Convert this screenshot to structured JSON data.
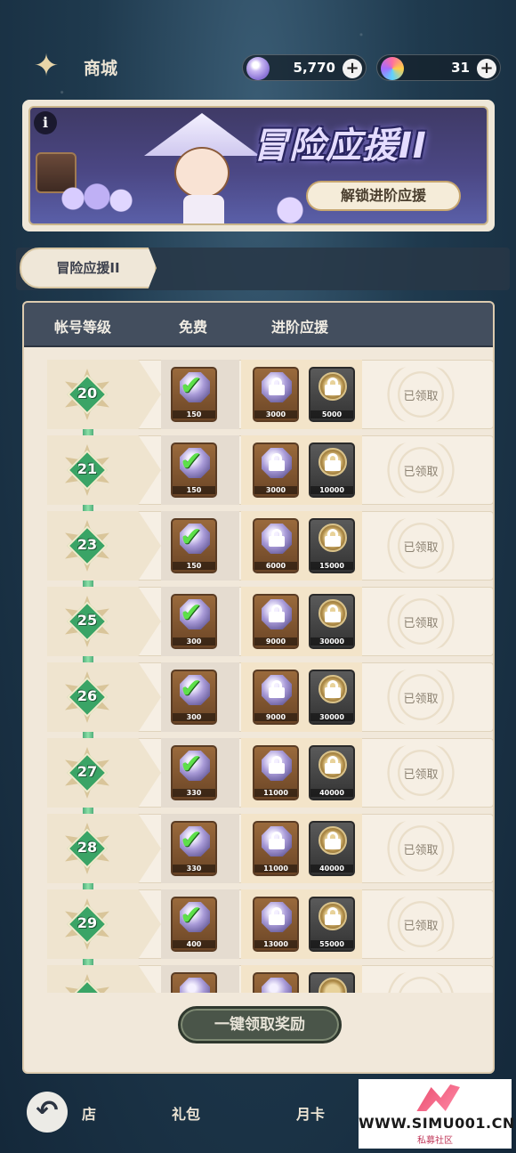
{
  "header": {
    "title": "商城",
    "currency_gems": "5,770",
    "currency_coins": "31",
    "plus": "+"
  },
  "banner": {
    "info": "i",
    "title": "冒险应援II",
    "unlock_button": "解锁进阶应援"
  },
  "tabs": [
    {
      "label": "冒险应援II",
      "active": true
    }
  ],
  "table": {
    "col_level": "帐号等级",
    "col_free": "免费",
    "col_advanced": "进阶应援",
    "claimed_label": "已领取",
    "rows": [
      {
        "level": "20",
        "free_qty": "150",
        "adv_gem_qty": "3000",
        "adv_coin_qty": "5000"
      },
      {
        "level": "21",
        "free_qty": "150",
        "adv_gem_qty": "3000",
        "adv_coin_qty": "10000"
      },
      {
        "level": "23",
        "free_qty": "150",
        "adv_gem_qty": "6000",
        "adv_coin_qty": "15000"
      },
      {
        "level": "25",
        "free_qty": "300",
        "adv_gem_qty": "9000",
        "adv_coin_qty": "30000"
      },
      {
        "level": "26",
        "free_qty": "300",
        "adv_gem_qty": "9000",
        "adv_coin_qty": "30000"
      },
      {
        "level": "27",
        "free_qty": "330",
        "adv_gem_qty": "11000",
        "adv_coin_qty": "40000"
      },
      {
        "level": "28",
        "free_qty": "330",
        "adv_gem_qty": "11000",
        "adv_coin_qty": "40000"
      },
      {
        "level": "29",
        "free_qty": "400",
        "adv_gem_qty": "13000",
        "adv_coin_qty": "55000"
      }
    ]
  },
  "claim_all_button": "一键领取奖励",
  "bottom_nav": {
    "back_icon": "back-arrow-icon",
    "items": [
      "店",
      "礼包",
      "月卡"
    ]
  },
  "watermark": {
    "text": "WWW.SIMU001.CN",
    "sub": "私募社区"
  },
  "colors": {
    "accent_green": "#3aa466",
    "panel_bg": "#f1e8da",
    "header_bg": "#434e5e"
  }
}
